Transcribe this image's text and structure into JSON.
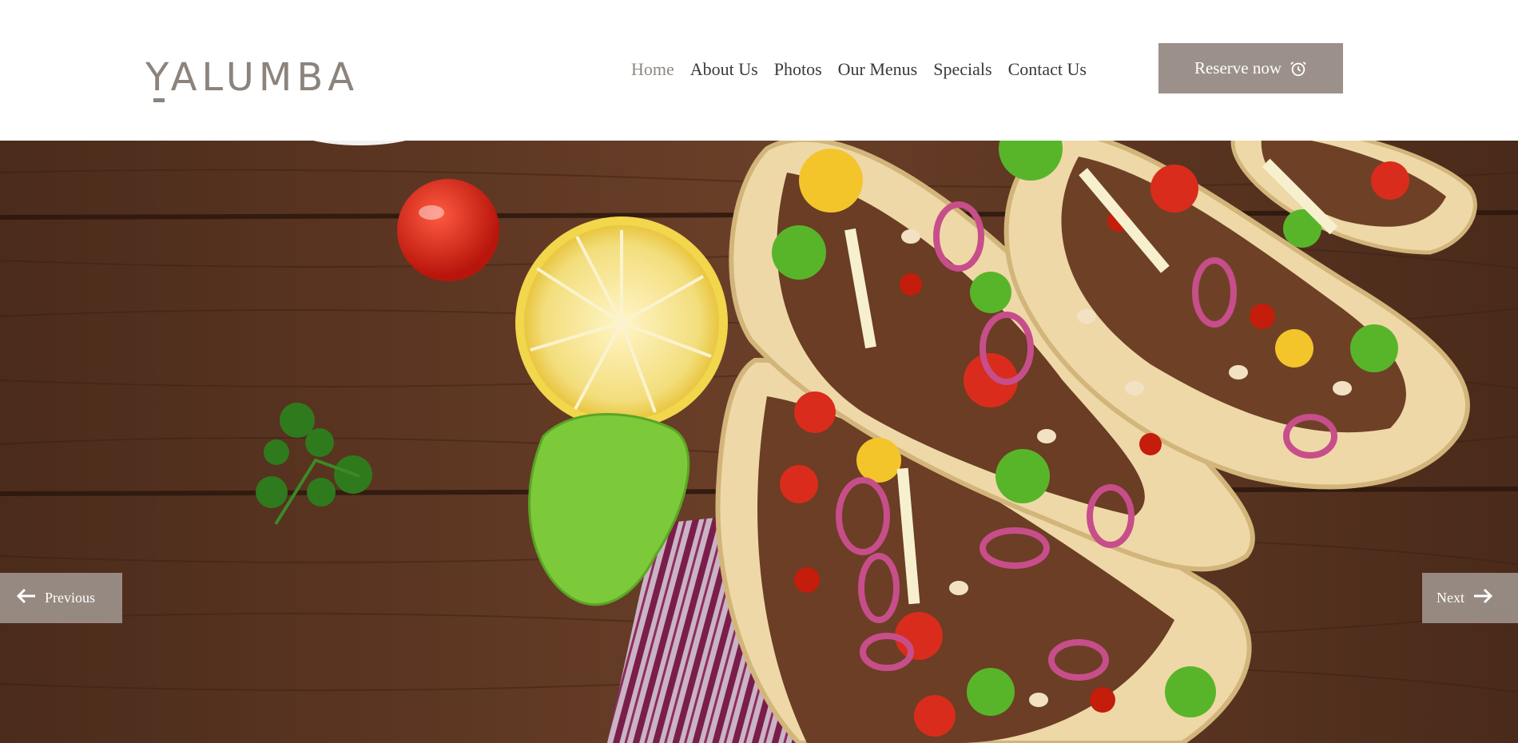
{
  "brand": {
    "logo_text": "YALUMBA"
  },
  "nav": {
    "items": [
      {
        "label": "Home",
        "active": true
      },
      {
        "label": "About Us",
        "active": false
      },
      {
        "label": "Photos",
        "active": false
      },
      {
        "label": "Our Menus",
        "active": false
      },
      {
        "label": "Specials",
        "active": false
      },
      {
        "label": "Contact Us",
        "active": false
      }
    ]
  },
  "header": {
    "reserve_label": "Reserve now",
    "reserve_icon": "alarm-clock-icon"
  },
  "slider": {
    "prev_label": "Previous",
    "next_label": "Next",
    "prev_icon": "arrow-left-icon",
    "next_icon": "arrow-right-icon"
  },
  "colors": {
    "brand": "#8c847c",
    "button_bg": "#9b918a",
    "nav_text": "#3c3a38",
    "nav_active": "#8e8880",
    "wood": "#5a3422"
  }
}
